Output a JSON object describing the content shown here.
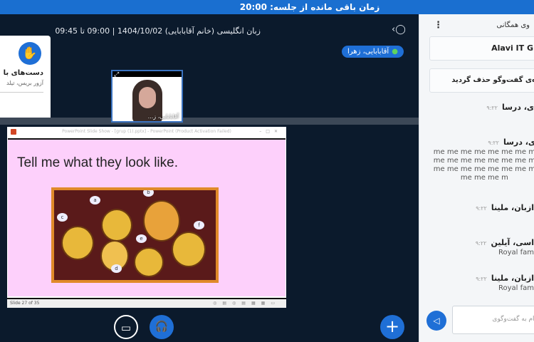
{
  "topbar": {
    "timer": "زمان باقی مانده از جلسه: 20:00"
  },
  "meeting": {
    "title": "زبان انگلیسی (خانم آقابابایی) 1404/10/02 | 09:00 تا 09:45",
    "talker": "آقابابایی، زهرا"
  },
  "popup": {
    "title": "دست‌های با",
    "subtitle": "آزور بریس، تیلد"
  },
  "webcam": {
    "name": "آقابابایی، ز..."
  },
  "presentation": {
    "window_title": "PowerPoint Slide Show - [grup (1).pptx] - PowerPoint (Product Activation Failed)",
    "slide_title": "Tell me what they look like.",
    "labels": [
      "a",
      "b",
      "c",
      "d",
      "e",
      "f"
    ],
    "status": "Slide 27 of 35"
  },
  "chat": {
    "title": "وی همگانی",
    "banner1": "Alavi IT G",
    "banner2": "ه‌ی گفت‌وگو حذف گردید",
    "messages": [
      {
        "name": "ی، درسا",
        "time": "۹:۲۲",
        "body": ""
      },
      {
        "name": "ی، درسا",
        "time": "۹:۲۲",
        "body": [
          "me me me me me me me m",
          "me me me me me me me m",
          "me me me me me me me m",
          "me me me m"
        ]
      },
      {
        "name": "ازبان، ملینا",
        "time": "۹:۲۲",
        "body": ""
      },
      {
        "name": "اسی، آیلین",
        "time": "۹:۲۲",
        "body": "Royal fam"
      },
      {
        "name": "ازبان، ملینا",
        "time": "۹:۲۲",
        "body": "Royal fam"
      }
    ],
    "placeholder": "پیام به گفت‌وگوی"
  },
  "colors": {
    "accent": "#1f6fd6",
    "background": "#0b1a2c",
    "slide": "#fdd0fb"
  }
}
